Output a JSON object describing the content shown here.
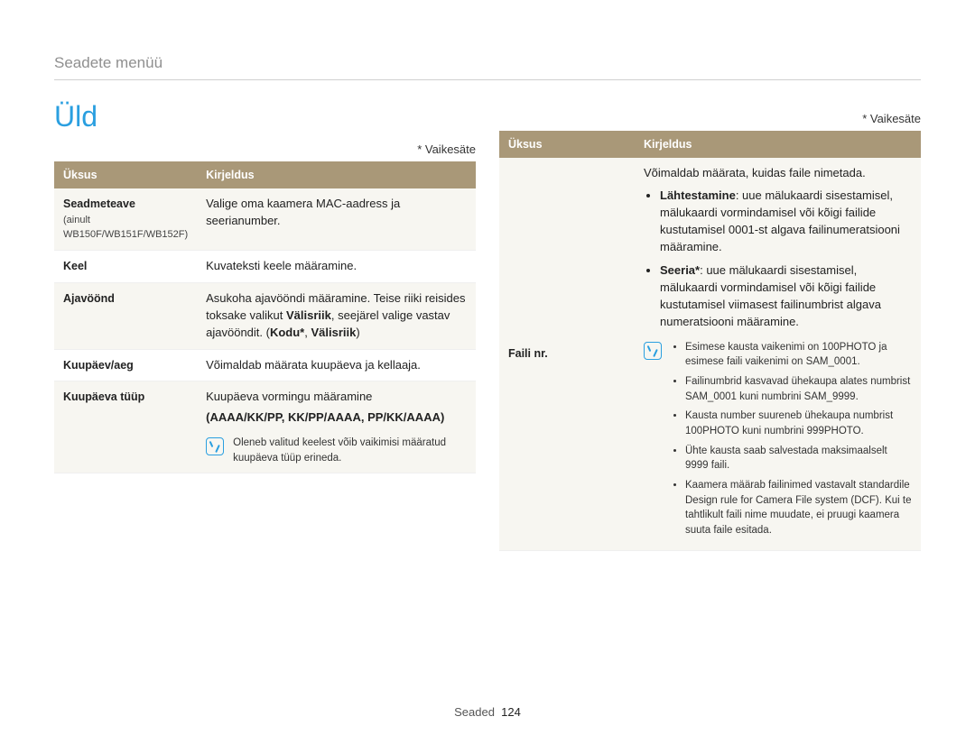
{
  "breadcrumb": "Seadete menüü",
  "title": "Üld",
  "default_note": "* Vaikesäte",
  "headers": {
    "item": "Üksus",
    "desc": "Kirjeldus"
  },
  "left": {
    "rows": {
      "seadmeteave": {
        "label": "Seadmeteave",
        "sub": "(ainult WB150F/WB151F/WB152F)",
        "desc": "Valige oma kaamera MAC-aadress ja seerianumber."
      },
      "keel": {
        "label": "Keel",
        "desc": "Kuvateksti keele määramine."
      },
      "ajavoond": {
        "label": "Ajavöönd",
        "desc1": "Asukoha ajavööndi määramine. Teise riiki reisides toksake valikut ",
        "bold1": "Välisriik",
        "desc2": ", seejärel valige vastav ajavööndit. (",
        "bold2": "Kodu*",
        "sep": ", ",
        "bold3": "Välisriik",
        "desc3": ")"
      },
      "kuupaev_aeg": {
        "label": "Kuupäev/aeg",
        "desc": "Võimaldab määrata kuupäeva ja kellaaja."
      },
      "kuupaeva_tuup": {
        "label": "Kuupäeva tüüp",
        "intro": "Kuupäeva vormingu määramine",
        "format": "AAAA/KK/PP",
        "sep": ", ",
        "format2": "KK/PP/AAAA",
        "format3": "PP/KK/AAAA",
        "note": "Oleneb valitud keelest võib vaikimisi määratud kuupäeva tüüp erineda."
      }
    }
  },
  "right": {
    "faili_nr": {
      "label": "Faili nr.",
      "intro": "Võimaldab määrata, kuidas faile nimetada.",
      "lahtestamine": {
        "bold": "Lähtestamine",
        "text": ": uue mälukaardi sisestamisel, mälukaardi vormindamisel või kõigi failide kustutamisel 0001-st algava failinumeratsiooni määramine."
      },
      "seeria": {
        "bold": "Seeria*",
        "text": ": uue mälukaardi sisestamisel, mälukaardi vormindamisel või kõigi failide kustutamisel viimasest failinumbrist algava numeratsiooni määramine."
      },
      "notes": {
        "n1": "Esimese kausta vaikenimi on 100PHOTO ja esimese faili vaikenimi on SAM_0001.",
        "n2": "Failinumbrid kasvavad ühekaupa alates numbrist SAM_0001 kuni numbrini SAM_9999.",
        "n3": "Kausta number suureneb ühekaupa numbrist 100PHOTO kuni numbrini 999PHOTO.",
        "n4": "Ühte kausta saab salvestada maksimaalselt 9999 faili.",
        "n5": "Kaamera määrab failinimed vastavalt standardile Design rule for Camera File system (DCF). Kui te tahtlikult faili nime muudate, ei pruugi kaamera suuta faile esitada."
      }
    }
  },
  "footer": {
    "section": "Seaded",
    "page": "124"
  }
}
